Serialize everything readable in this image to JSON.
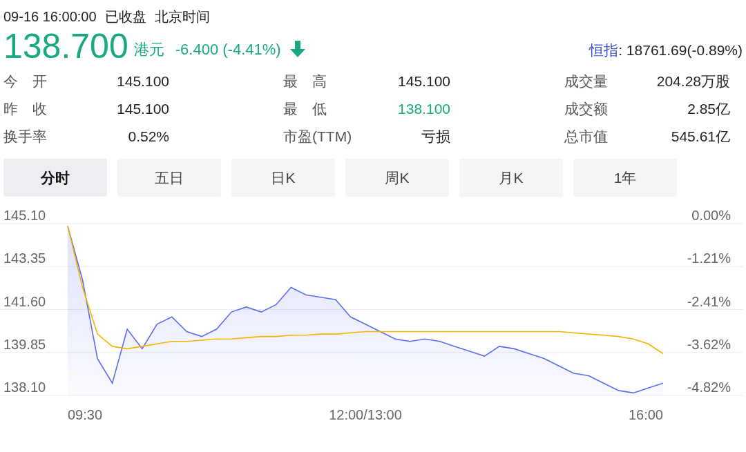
{
  "header": {
    "datetime": "09-16 16:00:00",
    "status": "已收盘",
    "timezone": "北京时间"
  },
  "quote": {
    "price": "138.700",
    "currency": "港元",
    "change": "-6.400 (-4.41%)",
    "index_name": "恒指",
    "index_value": ": 18761.69(-0.89%)"
  },
  "stats": [
    {
      "label": "今　开",
      "value": "145.100",
      "color": "#222222"
    },
    {
      "label": "最　高",
      "value": "145.100",
      "color": "#222222"
    },
    {
      "label": "成交量",
      "value": "204.28万股",
      "color": "#222222"
    },
    {
      "label": "昨　收",
      "value": "145.100",
      "color": "#222222"
    },
    {
      "label": "最　低",
      "value": "138.100",
      "color": "#19a980"
    },
    {
      "label": "成交额",
      "value": "2.85亿",
      "color": "#222222"
    },
    {
      "label": "换手率",
      "value": "0.52%",
      "color": "#222222"
    },
    {
      "label": "市盈(TTM)",
      "value": "亏损",
      "color": "#222222"
    },
    {
      "label": "总市值",
      "value": "545.61亿",
      "color": "#222222"
    }
  ],
  "tabs": [
    {
      "label": "分时",
      "selected": true
    },
    {
      "label": "五日",
      "selected": false
    },
    {
      "label": "日K",
      "selected": false
    },
    {
      "label": "周K",
      "selected": false
    },
    {
      "label": "月K",
      "selected": false
    },
    {
      "label": "1年",
      "selected": false
    }
  ],
  "chart": {
    "chart_data": {
      "type": "area",
      "grid": true,
      "ylim": [
        138.1,
        145.1
      ],
      "yticks": [
        {
          "value": 145.1,
          "label": "145.10"
        },
        {
          "value": 143.35,
          "label": "143.35"
        },
        {
          "value": 141.6,
          "label": "141.60"
        },
        {
          "value": 139.85,
          "label": "139.85"
        },
        {
          "value": 138.1,
          "label": "138.10"
        }
      ],
      "series": [
        {
          "type": "area",
          "color": "#5b6cf0",
          "values": [
            145.0,
            142.8,
            139.6,
            138.6,
            140.8,
            140.0,
            141.0,
            141.3,
            140.7,
            140.5,
            140.8,
            141.5,
            141.7,
            141.5,
            141.8,
            142.5,
            142.2,
            142.1,
            142.0,
            141.3,
            141.0,
            140.7,
            140.4,
            140.3,
            140.4,
            140.3,
            140.1,
            139.9,
            139.7,
            140.1,
            140.0,
            139.8,
            139.6,
            139.3,
            139.0,
            138.9,
            138.6,
            138.3,
            138.2,
            138.4,
            138.6
          ]
        },
        {
          "type": "line",
          "color": "#f5b400",
          "values": [
            145.0,
            142.5,
            140.6,
            140.1,
            140.0,
            140.1,
            140.2,
            140.3,
            140.3,
            140.35,
            140.4,
            140.4,
            140.45,
            140.5,
            140.5,
            140.55,
            140.55,
            140.6,
            140.6,
            140.65,
            140.7,
            140.7,
            140.7,
            140.7,
            140.7,
            140.7,
            140.7,
            140.7,
            140.7,
            140.7,
            140.7,
            140.7,
            140.7,
            140.7,
            140.65,
            140.6,
            140.55,
            140.5,
            140.4,
            140.2,
            139.8
          ]
        }
      ]
    },
    "time_labels": [
      "09:30",
      "12:00/13:00",
      "16:00"
    ],
    "right_axis_labels": [
      "0.00%",
      "-1.21%",
      "-2.41%",
      "-3.62%",
      "-4.82%"
    ]
  }
}
